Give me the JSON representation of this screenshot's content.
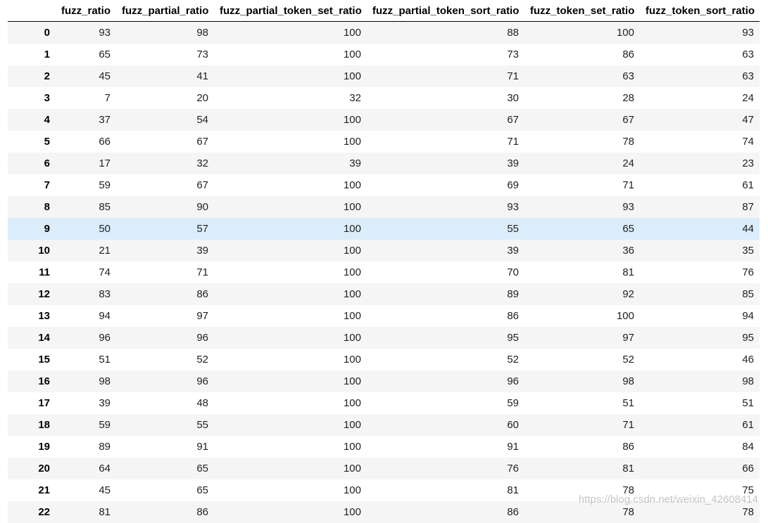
{
  "table": {
    "columns": [
      "",
      "fuzz_ratio",
      "fuzz_partial_ratio",
      "fuzz_partial_token_set_ratio",
      "fuzz_partial_token_sort_ratio",
      "fuzz_token_set_ratio",
      "fuzz_token_sort_ratio"
    ],
    "highlighted_row": 9,
    "rows": [
      {
        "index": "0",
        "values": [
          "93",
          "98",
          "100",
          "88",
          "100",
          "93"
        ]
      },
      {
        "index": "1",
        "values": [
          "65",
          "73",
          "100",
          "73",
          "86",
          "63"
        ]
      },
      {
        "index": "2",
        "values": [
          "45",
          "41",
          "100",
          "71",
          "63",
          "63"
        ]
      },
      {
        "index": "3",
        "values": [
          "7",
          "20",
          "32",
          "30",
          "28",
          "24"
        ]
      },
      {
        "index": "4",
        "values": [
          "37",
          "54",
          "100",
          "67",
          "67",
          "47"
        ]
      },
      {
        "index": "5",
        "values": [
          "66",
          "67",
          "100",
          "71",
          "78",
          "74"
        ]
      },
      {
        "index": "6",
        "values": [
          "17",
          "32",
          "39",
          "39",
          "24",
          "23"
        ]
      },
      {
        "index": "7",
        "values": [
          "59",
          "67",
          "100",
          "69",
          "71",
          "61"
        ]
      },
      {
        "index": "8",
        "values": [
          "85",
          "90",
          "100",
          "93",
          "93",
          "87"
        ]
      },
      {
        "index": "9",
        "values": [
          "50",
          "57",
          "100",
          "55",
          "65",
          "44"
        ]
      },
      {
        "index": "10",
        "values": [
          "21",
          "39",
          "100",
          "39",
          "36",
          "35"
        ]
      },
      {
        "index": "11",
        "values": [
          "74",
          "71",
          "100",
          "70",
          "81",
          "76"
        ]
      },
      {
        "index": "12",
        "values": [
          "83",
          "86",
          "100",
          "89",
          "92",
          "85"
        ]
      },
      {
        "index": "13",
        "values": [
          "94",
          "97",
          "100",
          "86",
          "100",
          "94"
        ]
      },
      {
        "index": "14",
        "values": [
          "96",
          "96",
          "100",
          "95",
          "97",
          "95"
        ]
      },
      {
        "index": "15",
        "values": [
          "51",
          "52",
          "100",
          "52",
          "52",
          "46"
        ]
      },
      {
        "index": "16",
        "values": [
          "98",
          "96",
          "100",
          "96",
          "98",
          "98"
        ]
      },
      {
        "index": "17",
        "values": [
          "39",
          "48",
          "100",
          "59",
          "51",
          "51"
        ]
      },
      {
        "index": "18",
        "values": [
          "59",
          "55",
          "100",
          "60",
          "71",
          "61"
        ]
      },
      {
        "index": "19",
        "values": [
          "89",
          "91",
          "100",
          "91",
          "86",
          "84"
        ]
      },
      {
        "index": "20",
        "values": [
          "64",
          "65",
          "100",
          "76",
          "81",
          "66"
        ]
      },
      {
        "index": "21",
        "values": [
          "45",
          "65",
          "100",
          "81",
          "78",
          "75"
        ]
      },
      {
        "index": "22",
        "values": [
          "81",
          "86",
          "100",
          "86",
          "78",
          "78"
        ]
      }
    ]
  },
  "watermark": {
    "text": "https://blog.csdn.net/weixin_42608414"
  }
}
